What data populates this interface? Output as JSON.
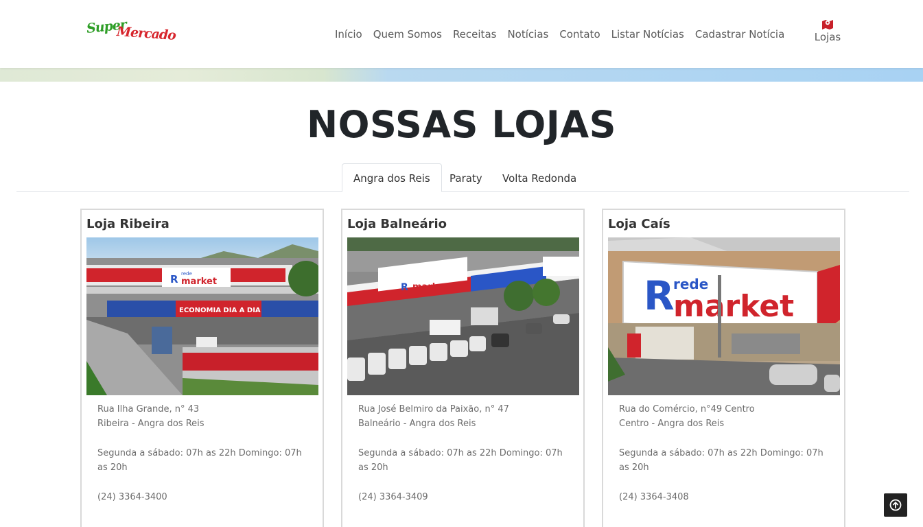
{
  "header": {
    "logo": {
      "part1": "Super",
      "part2": "Mercado"
    },
    "nav": [
      {
        "label": "Início"
      },
      {
        "label": "Quem Somos"
      },
      {
        "label": "Receitas"
      },
      {
        "label": "Notícias"
      },
      {
        "label": "Contato"
      },
      {
        "label": "Listar Notícias"
      },
      {
        "label": "Cadastrar Notícia"
      }
    ],
    "stores_link": {
      "label": "Lojas",
      "icon": "map-pin-icon"
    }
  },
  "main": {
    "title": "NOSSAS LOJAS",
    "tabs": [
      {
        "label": "Angra dos Reis",
        "active": true
      },
      {
        "label": "Paraty",
        "active": false
      },
      {
        "label": "Volta Redonda",
        "active": false
      }
    ],
    "stores": [
      {
        "name": "Loja Ribeira",
        "address": "Rua Ilha Grande, n° 43",
        "district": "Ribeira - Angra dos Reis",
        "hours": "Segunda a sábado: 07h as 22h Domingo: 07h as 20h",
        "phone": "(24) 3364-3400",
        "sign_text": "ECONOMIA DIA A DIA"
      },
      {
        "name": "Loja Balneário",
        "address": "Rua José Belmiro da Paixão, n° 47",
        "district": "Balneário - Angra dos Reis",
        "hours": "Segunda a sábado: 07h as 22h Domingo: 07h as 20h",
        "phone": "(24) 3364-3409"
      },
      {
        "name": "Loja Caís",
        "address": "Rua do Comércio, n°49 Centro",
        "district": "Centro - Angra dos Reis",
        "hours": "Segunda a sábado: 07h as 22h Domingo: 07h as 20h",
        "phone": "(24) 3364-3408"
      }
    ],
    "brand": {
      "rede": "rede",
      "market": "market"
    }
  },
  "colors": {
    "accent": "#d7262d",
    "green": "#2e9e27",
    "brand_blue": "#2a56c6"
  },
  "back_to_top_icon": "arrow-up-circle-icon"
}
